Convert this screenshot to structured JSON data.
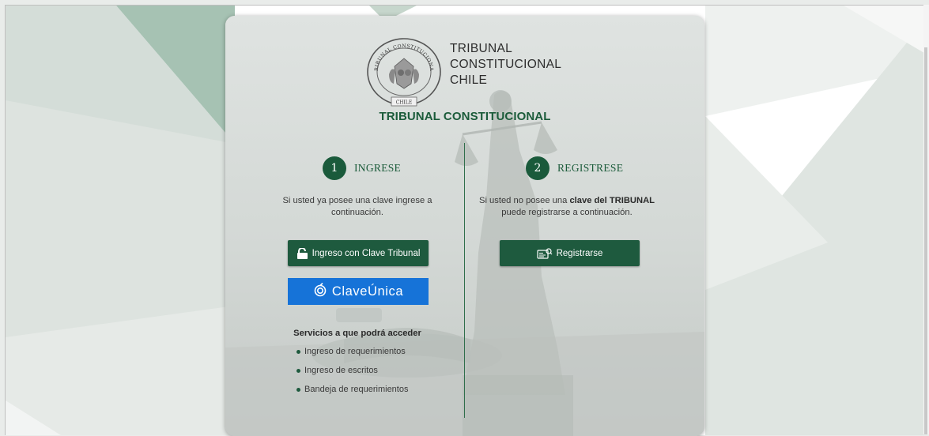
{
  "brand": {
    "seal_top_text": "TRIBUNAL CONSTITUCIONAL",
    "seal_bottom_text": "CHILE",
    "name_line1": "TRIBUNAL",
    "name_line2": "CONSTITUCIONAL",
    "name_line3": "CHILE"
  },
  "card_title": "TRIBUNAL CONSTITUCIONAL",
  "login": {
    "step_number": "1",
    "step_label": "INGRESE",
    "description": "Si usted ya posee una clave ingrese a continuación.",
    "tribunal_button_label": "Ingreso con Clave Tribunal",
    "claveunica_label": "ClaveÚnica",
    "services_title": "Servicios a que podrá acceder",
    "services": [
      "Ingreso de requerimientos",
      "Ingreso de escritos",
      "Bandeja de requerimientos"
    ]
  },
  "register": {
    "step_number": "2",
    "step_label": "REGISTRESE",
    "description_prefix": "Si usted no posee una ",
    "description_bold": "clave del TRIBUNAL",
    "description_suffix": "puede registrarse a continuación.",
    "button_label": "Registrarse"
  },
  "colors": {
    "primary_green": "#1e5a3e",
    "title_green": "#1b5b3a",
    "claveunica_blue": "#1673d8"
  }
}
